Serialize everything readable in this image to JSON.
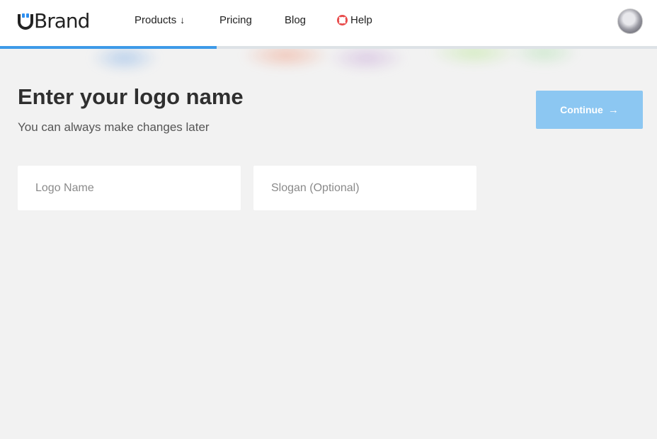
{
  "header": {
    "logo_text": "Brand",
    "nav": {
      "products": "Products",
      "products_arrow": "↓",
      "pricing": "Pricing",
      "blog": "Blog",
      "help": "Help"
    },
    "help_icon": "lifebuoy-icon",
    "avatar_icon": "user-avatar"
  },
  "progress": {
    "value_percent": 33,
    "color": "#3d9ae8"
  },
  "main": {
    "title": "Enter your logo name",
    "subtitle": "You can always make changes later",
    "continue_label": "Continue",
    "continue_arrow": "→",
    "logo_name": {
      "value": "",
      "placeholder": "Logo Name"
    },
    "slogan": {
      "value": "",
      "placeholder": "Slogan (Optional)"
    }
  },
  "colors": {
    "accent": "#2e8ff0",
    "button_disabled": "#8cc7f2",
    "background": "#f2f2f2"
  }
}
